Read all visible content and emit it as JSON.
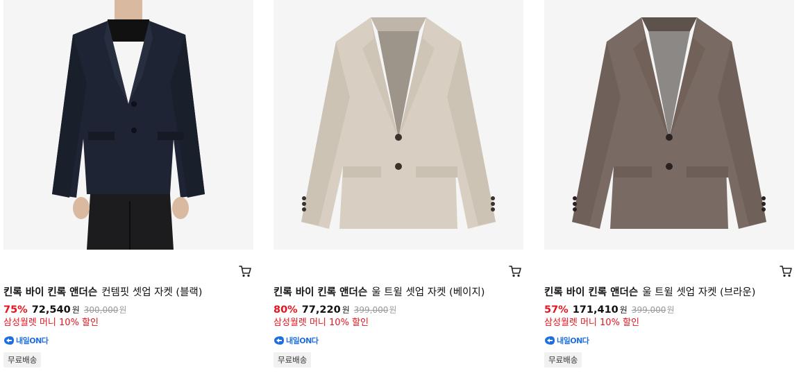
{
  "products": [
    {
      "brand": "킨록 바이 킨록 앤더슨",
      "name": "컨템핏 셋업 자켓 (블랙)",
      "discount": "75%",
      "price": "72,540",
      "currency": "원",
      "original_price": "300,000",
      "promo": "삼성월렛 머니 10% 할인",
      "delivery_badge": "내일ON다",
      "shipping": "무료배송",
      "jacket_color": "#1e2433"
    },
    {
      "brand": "킨록 바이 킨록 앤더슨",
      "name": "울 트윌 셋업 자켓 (베이지)",
      "discount": "80%",
      "price": "77,220",
      "currency": "원",
      "original_price": "399,000",
      "promo": "삼성월렛 머니 10% 할인",
      "delivery_badge": "내일ON다",
      "shipping": "무료배송",
      "jacket_color": "#d8cfc2"
    },
    {
      "brand": "킨록 바이 킨록 앤더슨",
      "name": "울 트윌 셋업 자켓 (브라운)",
      "discount": "57%",
      "price": "171,410",
      "currency": "원",
      "original_price": "399,000",
      "promo": "삼성월렛 머니 10% 할인",
      "delivery_badge": "내일ON다",
      "shipping": "무료배송",
      "jacket_color": "#7a6a64"
    }
  ],
  "colors": {
    "discount": "#e5141e",
    "promo": "#e5141e",
    "delivery_badge": "#1e6fe0",
    "original_price": "#999999"
  },
  "icons": {
    "cart": "cart-icon",
    "delivery": "rocket-delivery-icon"
  }
}
